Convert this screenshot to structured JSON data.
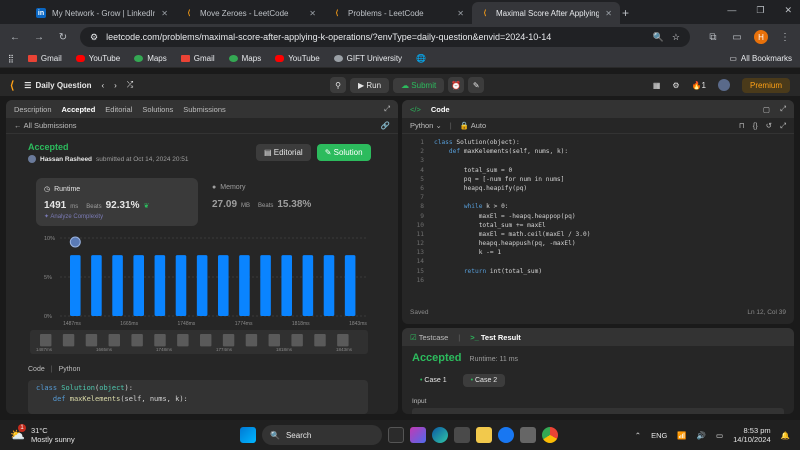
{
  "browser": {
    "tabs": [
      {
        "icon": "linkedin-icon",
        "title": "My Network - Grow | LinkedIn"
      },
      {
        "icon": "leetcode-icon",
        "title": "Move Zeroes - LeetCode"
      },
      {
        "icon": "leetcode-icon",
        "title": "Problems - LeetCode"
      },
      {
        "icon": "leetcode-icon",
        "title": "Maximal Score After Applying K"
      }
    ],
    "url": "leetcode.com/problems/maximal-score-after-applying-k-operations/?envType=daily-question&envid=2024-10-14",
    "profile_letter": "H",
    "bookmarks": [
      "Gmail",
      "YouTube",
      "Maps",
      "Gmail",
      "Maps",
      "YouTube",
      "GIFT University"
    ],
    "all_bookmarks": "All Bookmarks"
  },
  "lcnav": {
    "daily": "Daily Question",
    "run": "Run",
    "submit": "Submit",
    "streak": "1",
    "premium": "Premium"
  },
  "left": {
    "tabs": [
      "Description",
      "Accepted",
      "Editorial",
      "Solutions",
      "Submissions"
    ],
    "all_submissions": "All Submissions",
    "status": "Accepted",
    "user": "Hassan Rasheed",
    "submitted_at": "submitted at Oct 14, 2024 20:51",
    "editorial_btn": "Editorial",
    "solution_btn": "Solution",
    "runtime_label": "Runtime",
    "runtime_value": "1491",
    "runtime_unit": "ms",
    "beats_label": "Beats",
    "runtime_beats": "92.31%",
    "analyze": "Analyze Complexity",
    "memory_label": "Memory",
    "memory_value": "27.09",
    "memory_unit": "MB",
    "memory_beats": "15.38%",
    "code_label": "Code",
    "code_lang": "Python",
    "code_preview": [
      "class Solution(object):",
      "    def maxKelements(self, nums, k):"
    ]
  },
  "chart_data": {
    "type": "bar",
    "yticks": [
      "10%",
      "5%",
      "0%"
    ],
    "ylim": [
      0,
      10
    ],
    "values": [
      7.8,
      7.8,
      7.8,
      7.8,
      7.8,
      7.8,
      7.8,
      7.8,
      7.8,
      7.8,
      7.8,
      7.8,
      7.8,
      7.8
    ],
    "xlabels": [
      "1487ms",
      "1665ms",
      "1748ms",
      "1774ms",
      "1818ms",
      "1843ms"
    ],
    "mini_labels": [
      "1487ms",
      "1665ms",
      "1748ms",
      "1774ms",
      "1818ms",
      "1843ms"
    ]
  },
  "code": {
    "title": "Code",
    "lang": "Python",
    "auto": "Auto",
    "saved": "Saved",
    "position": "Ln 12, Col 39",
    "lines": [
      "class Solution(object):",
      "    def maxKelements(self, nums, k):",
      "",
      "        total_sum = 0",
      "        pq = [-num for num in nums]",
      "        heapq.heapify(pq)",
      "",
      "        while k > 0:",
      "            maxEl = -heapq.heappop(pq)",
      "            total_sum += maxEl",
      "            maxEl = math.ceil(maxEl / 3.0)",
      "            heapq.heappush(pq, -maxEl)",
      "            k -= 1",
      "",
      "        return int(total_sum)",
      ""
    ]
  },
  "result": {
    "tabs": [
      "Testcase",
      "Test Result"
    ],
    "status": "Accepted",
    "runtime": "Runtime: 11 ms",
    "cases": [
      "Case 1",
      "Case 2"
    ],
    "input_label": "Input"
  },
  "taskbar": {
    "temp": "31°C",
    "weather": "Mostly sunny",
    "search": "Search",
    "lang": "ENG",
    "time": "8:53 pm",
    "date": "14/10/2024"
  }
}
